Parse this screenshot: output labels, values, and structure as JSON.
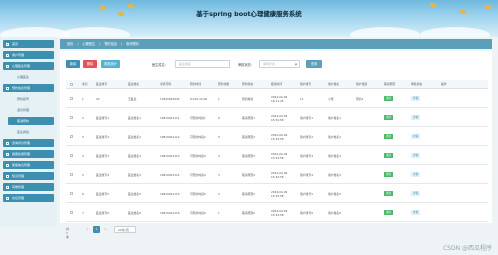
{
  "header": {
    "title": "基于spring boot心理健康服务系统"
  },
  "sidebar": {
    "items": [
      {
        "label": "首页"
      },
      {
        "label": "用户管理"
      },
      {
        "label": "心理医生管理"
      },
      {
        "label": "心理医生"
      },
      {
        "label": "预约信息管理"
      },
      {
        "label": "预约挂号"
      },
      {
        "label": "退诊管理"
      },
      {
        "label": "取消预约"
      },
      {
        "label": "医生排班"
      },
      {
        "label": "咨询问诊管理"
      },
      {
        "label": "健康检测管理"
      },
      {
        "label": "疾病信息管理"
      },
      {
        "label": "知识管理"
      },
      {
        "label": "问卷管理"
      },
      {
        "label": "论坛管理"
      }
    ],
    "active_sub": "取消预约"
  },
  "breadcrumb": {
    "home": "首页",
    "sep": "/",
    "l1": "心理医生",
    "l2": "预约信息",
    "l3": "取消预约"
  },
  "toolbar": {
    "add": "新增",
    "delete": "删除",
    "stats": "报表统计",
    "doctor_label": "医生姓名:",
    "doctor_placeholder": "医生姓名",
    "status_label": "审核状态:",
    "status_placeholder": "审核状态",
    "search": "查询"
  },
  "table": {
    "headers": [
      "",
      "索引",
      "医生账号",
      "医生姓名",
      "手机号码",
      "预约时间",
      "预约金额",
      "预约状态",
      "取消时间",
      "用户账号",
      "用户姓名",
      "用户性别",
      "取消原因",
      "审核状态",
      "操作"
    ],
    "rows": [
      [
        "",
        "1",
        "22",
        "王医生",
        "13645645645",
        "8:100-12:00",
        "1",
        "预约成功",
        "2024-04-09 16:11:45",
        "11",
        "小张",
        "预约1",
        "通过",
        "详情"
      ],
      [
        "",
        "2",
        "医生账号1",
        "医生姓名1",
        "19810001111",
        "可预约时段1",
        "6",
        "取消原因1",
        "2024-04-09 15:34:58",
        "用户账号1",
        "用户姓名1",
        "",
        "通过",
        "详情"
      ],
      [
        "",
        "3",
        "医生账号2",
        "医生姓名2",
        "19810001112",
        "可预约时段2",
        "5",
        "取消原因2",
        "2024-04-09 15:34:58",
        "用户账号2",
        "用户姓名2",
        "",
        "通过",
        "详情"
      ],
      [
        "",
        "4",
        "医生账号3",
        "医生姓名3",
        "19810001113",
        "可预约时段3",
        "4",
        "取消原因3",
        "2024-04-09 15:34:58",
        "用户账号3",
        "用户姓名3",
        "",
        "通过",
        "详情"
      ],
      [
        "",
        "5",
        "医生账号4",
        "医生姓名4",
        "19810001114",
        "可预约时段4",
        "3",
        "取消原因4",
        "2024-04-09 15:34:58",
        "用户账号4",
        "用户姓名4",
        "",
        "通过",
        "详情"
      ],
      [
        "",
        "6",
        "医生账号5",
        "医生姓名5",
        "19810001115",
        "可预约时段5",
        "2",
        "取消原因5",
        "2024-04-09 15:34:58",
        "用户账号5",
        "用户姓名5",
        "",
        "通过",
        "详情"
      ],
      [
        "",
        "7",
        "医生账号6",
        "医生姓名6",
        "19810001116",
        "可预约时段6",
        "1",
        "取消原因6",
        "2024-04-09 15:34:58",
        "用户账号6",
        "用户姓名6",
        "",
        "通过",
        "详情"
      ]
    ]
  },
  "pager": {
    "total": "共7条",
    "prev": "<",
    "page": "1",
    "next": ">",
    "page_size": "20条/页"
  },
  "watermark": "CSDN @西瓜程序",
  "colors": {
    "primary": "#3e8fb3",
    "danger": "#e8505a",
    "success": "#4ab96a",
    "header_sky": "#6fb8dd"
  }
}
